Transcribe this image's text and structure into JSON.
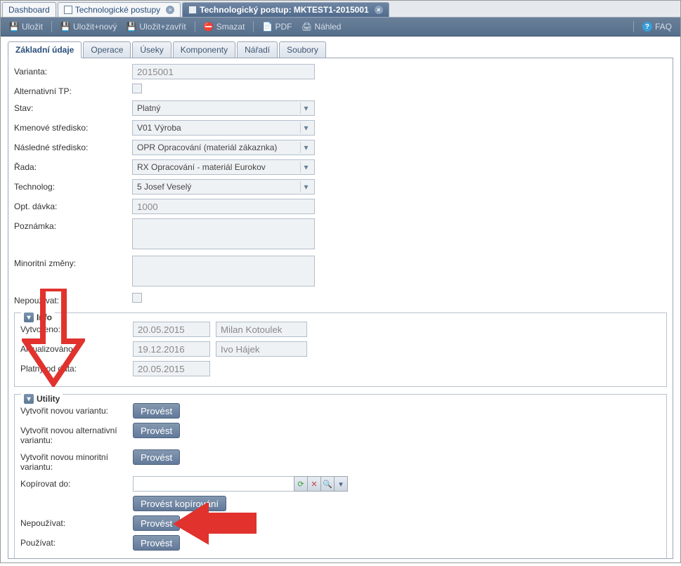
{
  "doc_tabs": {
    "dashboard": "Dashboard",
    "list": "Technologické postupy",
    "detail": "Technologický postup: MKTEST1-2015001"
  },
  "toolbar": {
    "save": "Uložit",
    "save_new": "Uložit+nový",
    "save_close": "Uložit+zavřít",
    "delete": "Smazat",
    "pdf": "PDF",
    "preview": "Náhled",
    "faq": "FAQ"
  },
  "inner_tabs": {
    "basic": "Základní údaje",
    "operations": "Operace",
    "sections": "Úseky",
    "components": "Komponenty",
    "tools": "Nářadí",
    "files": "Soubory"
  },
  "fields": {
    "variant_label": "Varianta:",
    "variant_value": "2015001",
    "alt_tp_label": "Alternativní TP:",
    "status_label": "Stav:",
    "status_value": "Platný",
    "kmen_label": "Kmenové středisko:",
    "kmen_value": "V01 Výroba",
    "nasl_label": "Následné středisko:",
    "nasl_value": "OPR Opracování (materiál zákaznka)",
    "rada_label": "Řada:",
    "rada_value": "RX Opracování - materiál Eurokov",
    "tech_label": "Technolog:",
    "tech_value": "5 Josef Veselý",
    "opt_label": "Opt. dávka:",
    "opt_value": "1000",
    "note_label": "Poznámka:",
    "note_value": "",
    "minor_label": "Minoritní změny:",
    "minor_value": "",
    "nepouzivat_chk_label": "Nepoužívat:"
  },
  "info": {
    "title": "Info",
    "created_label": "Vytvořeno:",
    "created_date": "20.05.2015",
    "created_user": "Milan Kotoulek",
    "updated_label": "Aktualizováno:",
    "updated_date": "19.12.2016",
    "updated_user": "Ivo Hájek",
    "valid_label": "Platný od data:",
    "valid_date": "20.05.2015"
  },
  "utility": {
    "title": "Utility",
    "new_variant_label": "Vytvořit novou variantu:",
    "new_alt_label": "Vytvořit novou alternativní variantu:",
    "new_minor_label": "Vytvořit novou minoritní variantu:",
    "copy_label": "Kopírovat do:",
    "copy_value": "",
    "copy_btn": "Provést kopírování",
    "nepouzivat_label": "Nepoužívat:",
    "pouzivat_label": "Používat:",
    "provest": "Provést"
  }
}
